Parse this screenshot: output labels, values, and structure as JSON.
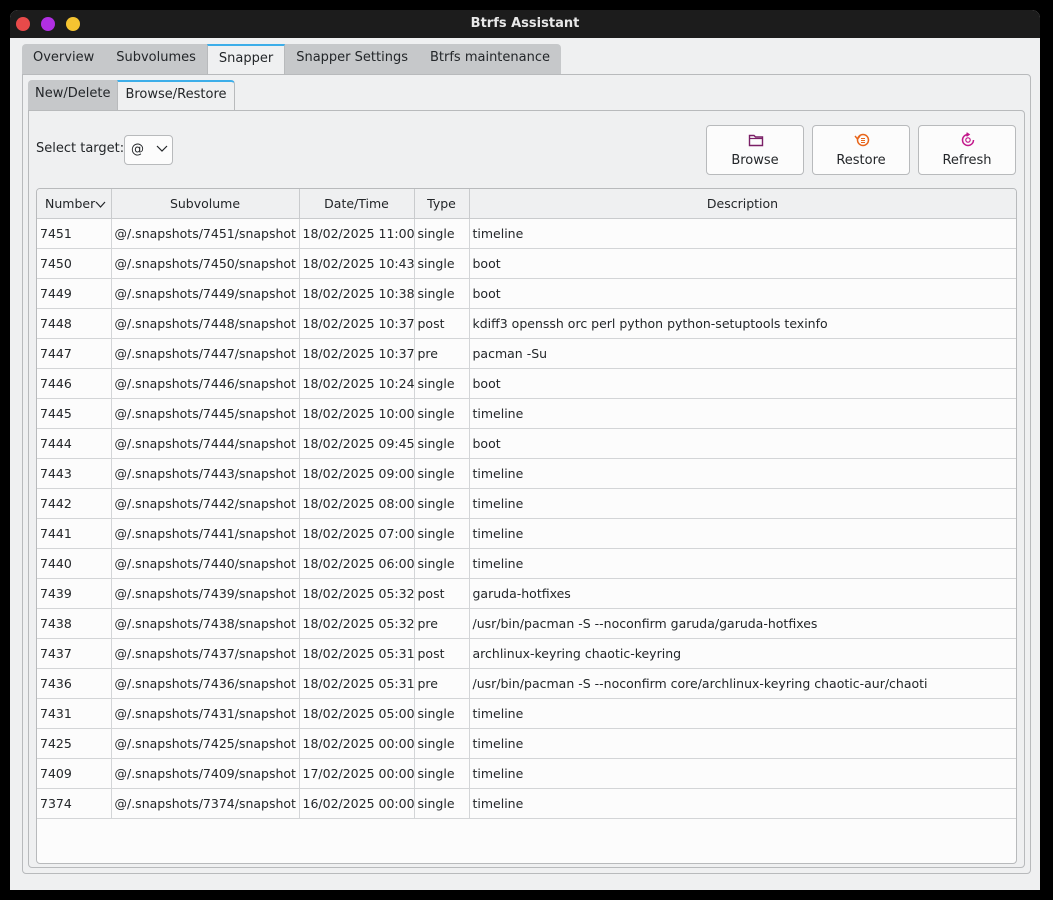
{
  "window": {
    "title": "Btrfs Assistant"
  },
  "tabs": [
    "Overview",
    "Subvolumes",
    "Snapper",
    "Snapper Settings",
    "Btrfs maintenance"
  ],
  "active_tab": "Snapper",
  "subtabs": [
    "New/Delete",
    "Browse/Restore"
  ],
  "active_subtab": "Browse/Restore",
  "target": {
    "label": "Select target:",
    "value": "@"
  },
  "buttons": {
    "browse": {
      "label": "Browse",
      "icon": "folder-icon"
    },
    "restore": {
      "label": "Restore",
      "icon": "restore-icon"
    },
    "refresh": {
      "label": "Refresh",
      "icon": "refresh-icon"
    }
  },
  "colors": {
    "accent": "#3daee9",
    "icon_purple": "#7a1f66",
    "icon_orange": "#e8651a",
    "icon_magenta": "#c2188b"
  },
  "table": {
    "columns": [
      "Number",
      "Subvolume",
      "Date/Time",
      "Type",
      "Description"
    ],
    "sort_column": "Number",
    "rows": [
      [
        "7451",
        "@/.snapshots/7451/snapshot",
        "18/02/2025 11:00",
        "single",
        "timeline"
      ],
      [
        "7450",
        "@/.snapshots/7450/snapshot",
        "18/02/2025 10:43",
        "single",
        "boot"
      ],
      [
        "7449",
        "@/.snapshots/7449/snapshot",
        "18/02/2025 10:38",
        "single",
        "boot"
      ],
      [
        "7448",
        "@/.snapshots/7448/snapshot",
        "18/02/2025 10:37",
        "post",
        "kdiff3 openssh orc perl python python-setuptools texinfo"
      ],
      [
        "7447",
        "@/.snapshots/7447/snapshot",
        "18/02/2025 10:37",
        "pre",
        "pacman -Su"
      ],
      [
        "7446",
        "@/.snapshots/7446/snapshot",
        "18/02/2025 10:24",
        "single",
        "boot"
      ],
      [
        "7445",
        "@/.snapshots/7445/snapshot",
        "18/02/2025 10:00",
        "single",
        "timeline"
      ],
      [
        "7444",
        "@/.snapshots/7444/snapshot",
        "18/02/2025 09:45",
        "single",
        "boot"
      ],
      [
        "7443",
        "@/.snapshots/7443/snapshot",
        "18/02/2025 09:00",
        "single",
        "timeline"
      ],
      [
        "7442",
        "@/.snapshots/7442/snapshot",
        "18/02/2025 08:00",
        "single",
        "timeline"
      ],
      [
        "7441",
        "@/.snapshots/7441/snapshot",
        "18/02/2025 07:00",
        "single",
        "timeline"
      ],
      [
        "7440",
        "@/.snapshots/7440/snapshot",
        "18/02/2025 06:00",
        "single",
        "timeline"
      ],
      [
        "7439",
        "@/.snapshots/7439/snapshot",
        "18/02/2025 05:32",
        "post",
        "garuda-hotfixes"
      ],
      [
        "7438",
        "@/.snapshots/7438/snapshot",
        "18/02/2025 05:32",
        "pre",
        "/usr/bin/pacman -S --noconfirm garuda/garuda-hotfixes"
      ],
      [
        "7437",
        "@/.snapshots/7437/snapshot",
        "18/02/2025 05:31",
        "post",
        "archlinux-keyring chaotic-keyring"
      ],
      [
        "7436",
        "@/.snapshots/7436/snapshot",
        "18/02/2025 05:31",
        "pre",
        "/usr/bin/pacman -S --noconfirm core/archlinux-keyring chaotic-aur/chaoti"
      ],
      [
        "7431",
        "@/.snapshots/7431/snapshot",
        "18/02/2025 05:00",
        "single",
        "timeline"
      ],
      [
        "7425",
        "@/.snapshots/7425/snapshot",
        "18/02/2025 00:00",
        "single",
        "timeline"
      ],
      [
        "7409",
        "@/.snapshots/7409/snapshot",
        "17/02/2025 00:00",
        "single",
        "timeline"
      ],
      [
        "7374",
        "@/.snapshots/7374/snapshot",
        "16/02/2025 00:00",
        "single",
        "timeline"
      ]
    ]
  }
}
